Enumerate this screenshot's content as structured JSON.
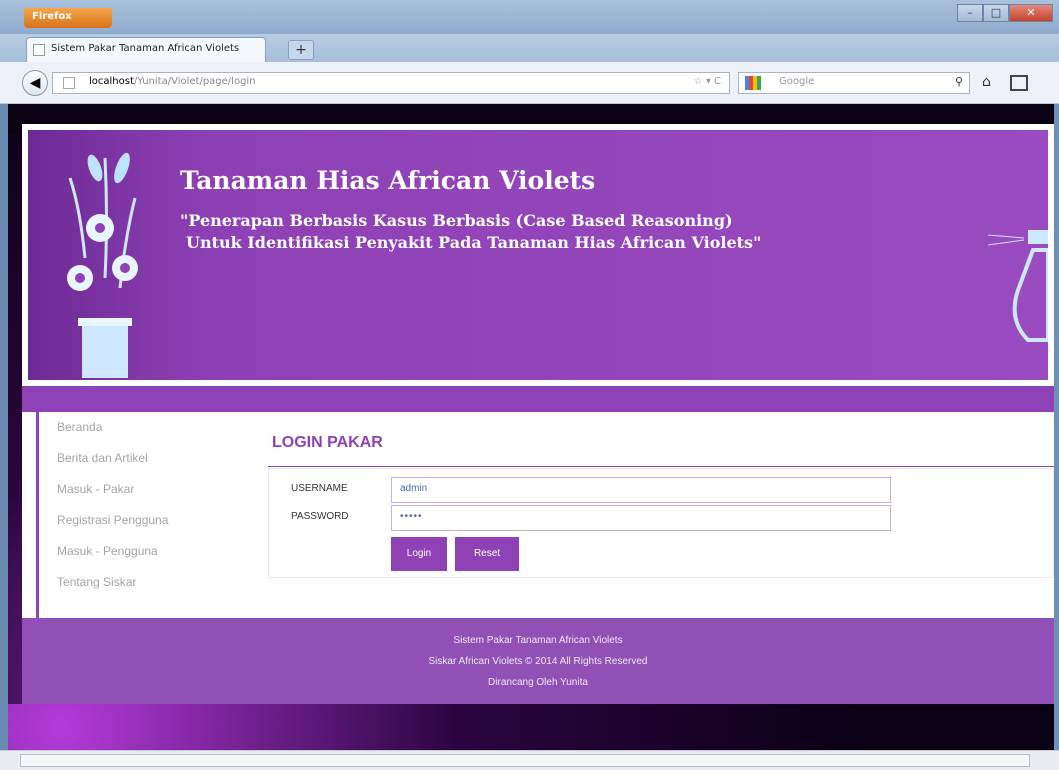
{
  "browser": {
    "menu_button": "Firefox",
    "tab_title": "Sistem Pakar Tanaman African Violets",
    "url_host": "localhost",
    "url_path": "/Yunita/Violet/page/login",
    "search_placeholder": "Google"
  },
  "header": {
    "title": "Tanaman Hias African Violets",
    "subtitle_line1": "\"Penerapan Berbasis Kasus Berbasis (Case Based Reasoning)",
    "subtitle_line2": "Untuk Identifikasi Penyakit Pada Tanaman Hias African Violets\""
  },
  "sidebar": {
    "items": [
      {
        "label": "Beranda"
      },
      {
        "label": "Berita dan Artikel"
      },
      {
        "label": "Masuk - Pakar"
      },
      {
        "label": "Registrasi Pengguna"
      },
      {
        "label": "Masuk - Pengguna"
      },
      {
        "label": "Tentang Siskar"
      }
    ]
  },
  "login": {
    "title": "LOGIN PAKAR",
    "username_label": "USERNAME",
    "username_value": "admin",
    "password_label": "PASSWORD",
    "password_value": "•••••",
    "login_button": "Login",
    "reset_button": "Reset"
  },
  "footer": {
    "line1": "Sistem Pakar Tanaman African Violets",
    "line2": "Siskar African Violets © 2014 All Rights Reserved",
    "line3": "Dirancang Oleh Yunita"
  },
  "colors": {
    "brand_purple": "#8f41b6",
    "footer_purple": "#9050b6"
  }
}
